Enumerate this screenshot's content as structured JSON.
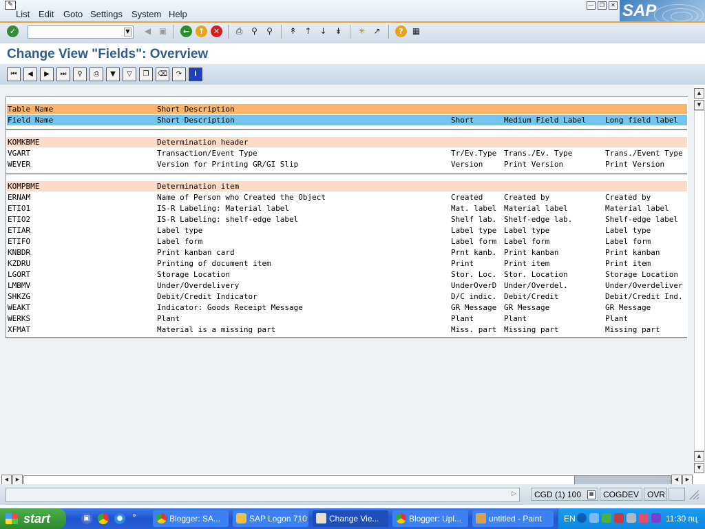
{
  "menu": {
    "items": [
      "List",
      "Edit",
      "Goto",
      "Settings",
      "System",
      "Help"
    ]
  },
  "brand": {
    "logo": "SAP"
  },
  "toolbar": {
    "command_value": ""
  },
  "page": {
    "title": "Change View \"Fields\": Overview"
  },
  "table": {
    "header1": [
      "Table Name",
      "Short Description",
      "",
      "",
      ""
    ],
    "header2": [
      "Field Name",
      "Short Description",
      "Short",
      "Medium Field Label",
      "Long field label"
    ],
    "groups": [
      {
        "row": [
          "KOMKBME",
          "Determination header",
          "",
          "",
          ""
        ],
        "fields": [
          [
            "VGART",
            "Transaction/Event Type",
            "Tr/Ev.Type",
            "Trans./Ev. Type",
            "Trans./Event Type"
          ],
          [
            "WEVER",
            "Version for Printing GR/GI Slip",
            "Version",
            "Print Version",
            "Print Version"
          ]
        ]
      },
      {
        "row": [
          "KOMPBME",
          "Determination item",
          "",
          "",
          ""
        ],
        "fields": [
          [
            "ERNAM",
            "Name of Person who Created the Object",
            "Created",
            "Created by",
            "Created by"
          ],
          [
            "ETIO1",
            "IS-R Labeling: Material label",
            "Mat. label",
            "Material label",
            "Material label"
          ],
          [
            "ETIO2",
            "IS-R Labeling: shelf-edge label",
            "Shelf lab.",
            "Shelf-edge lab.",
            "Shelf-edge label"
          ],
          [
            "ETIAR",
            "Label type",
            "Label type",
            "Label type",
            "Label type"
          ],
          [
            "ETIFO",
            "Label form",
            "Label form",
            "Label form",
            "Label form"
          ],
          [
            "KNBDR",
            "Print kanban card",
            "Prnt kanb.",
            "Print kanban",
            "Print kanban"
          ],
          [
            "KZDRU",
            "Printing of document item",
            "Print",
            "Print item",
            "Print item"
          ],
          [
            "LGORT",
            "Storage Location",
            "Stor. Loc.",
            "Stor. Location",
            "Storage Location"
          ],
          [
            "LMBMV",
            "Under/Overdelivery",
            "UnderOverD",
            "Under/Overdel.",
            "Under/Overdeliver"
          ],
          [
            "SHKZG",
            "Debit/Credit Indicator",
            "D/C indic.",
            "Debit/Credit",
            "Debit/Credit Ind."
          ],
          [
            "WEAKT",
            "Indicator: Goods Receipt Message",
            "GR Message",
            "GR Message",
            "GR Message"
          ],
          [
            "WERKS",
            "Plant",
            "Plant",
            "Plant",
            "Plant"
          ],
          [
            "XFMAT",
            "Material is a missing part",
            "Miss. part",
            "Missing part",
            "Missing part"
          ]
        ]
      }
    ]
  },
  "status": {
    "system": "CGD (1) 100",
    "server": "COGDEV",
    "mode": "OVR"
  },
  "taskbar": {
    "start_label": "start",
    "tasks": [
      "Blogger: SA...",
      "SAP Logon 710",
      "Change Vie...",
      "Blogger: Upl...",
      "untitled - Paint"
    ],
    "language": "EN",
    "clock": "11:30 пц"
  },
  "colors": {
    "header1": "#fcb66c",
    "header2": "#71c5f0",
    "group_row": "#fcdcc6",
    "title": "#2f5c8c",
    "toolbar_accent": "#f0a030"
  }
}
